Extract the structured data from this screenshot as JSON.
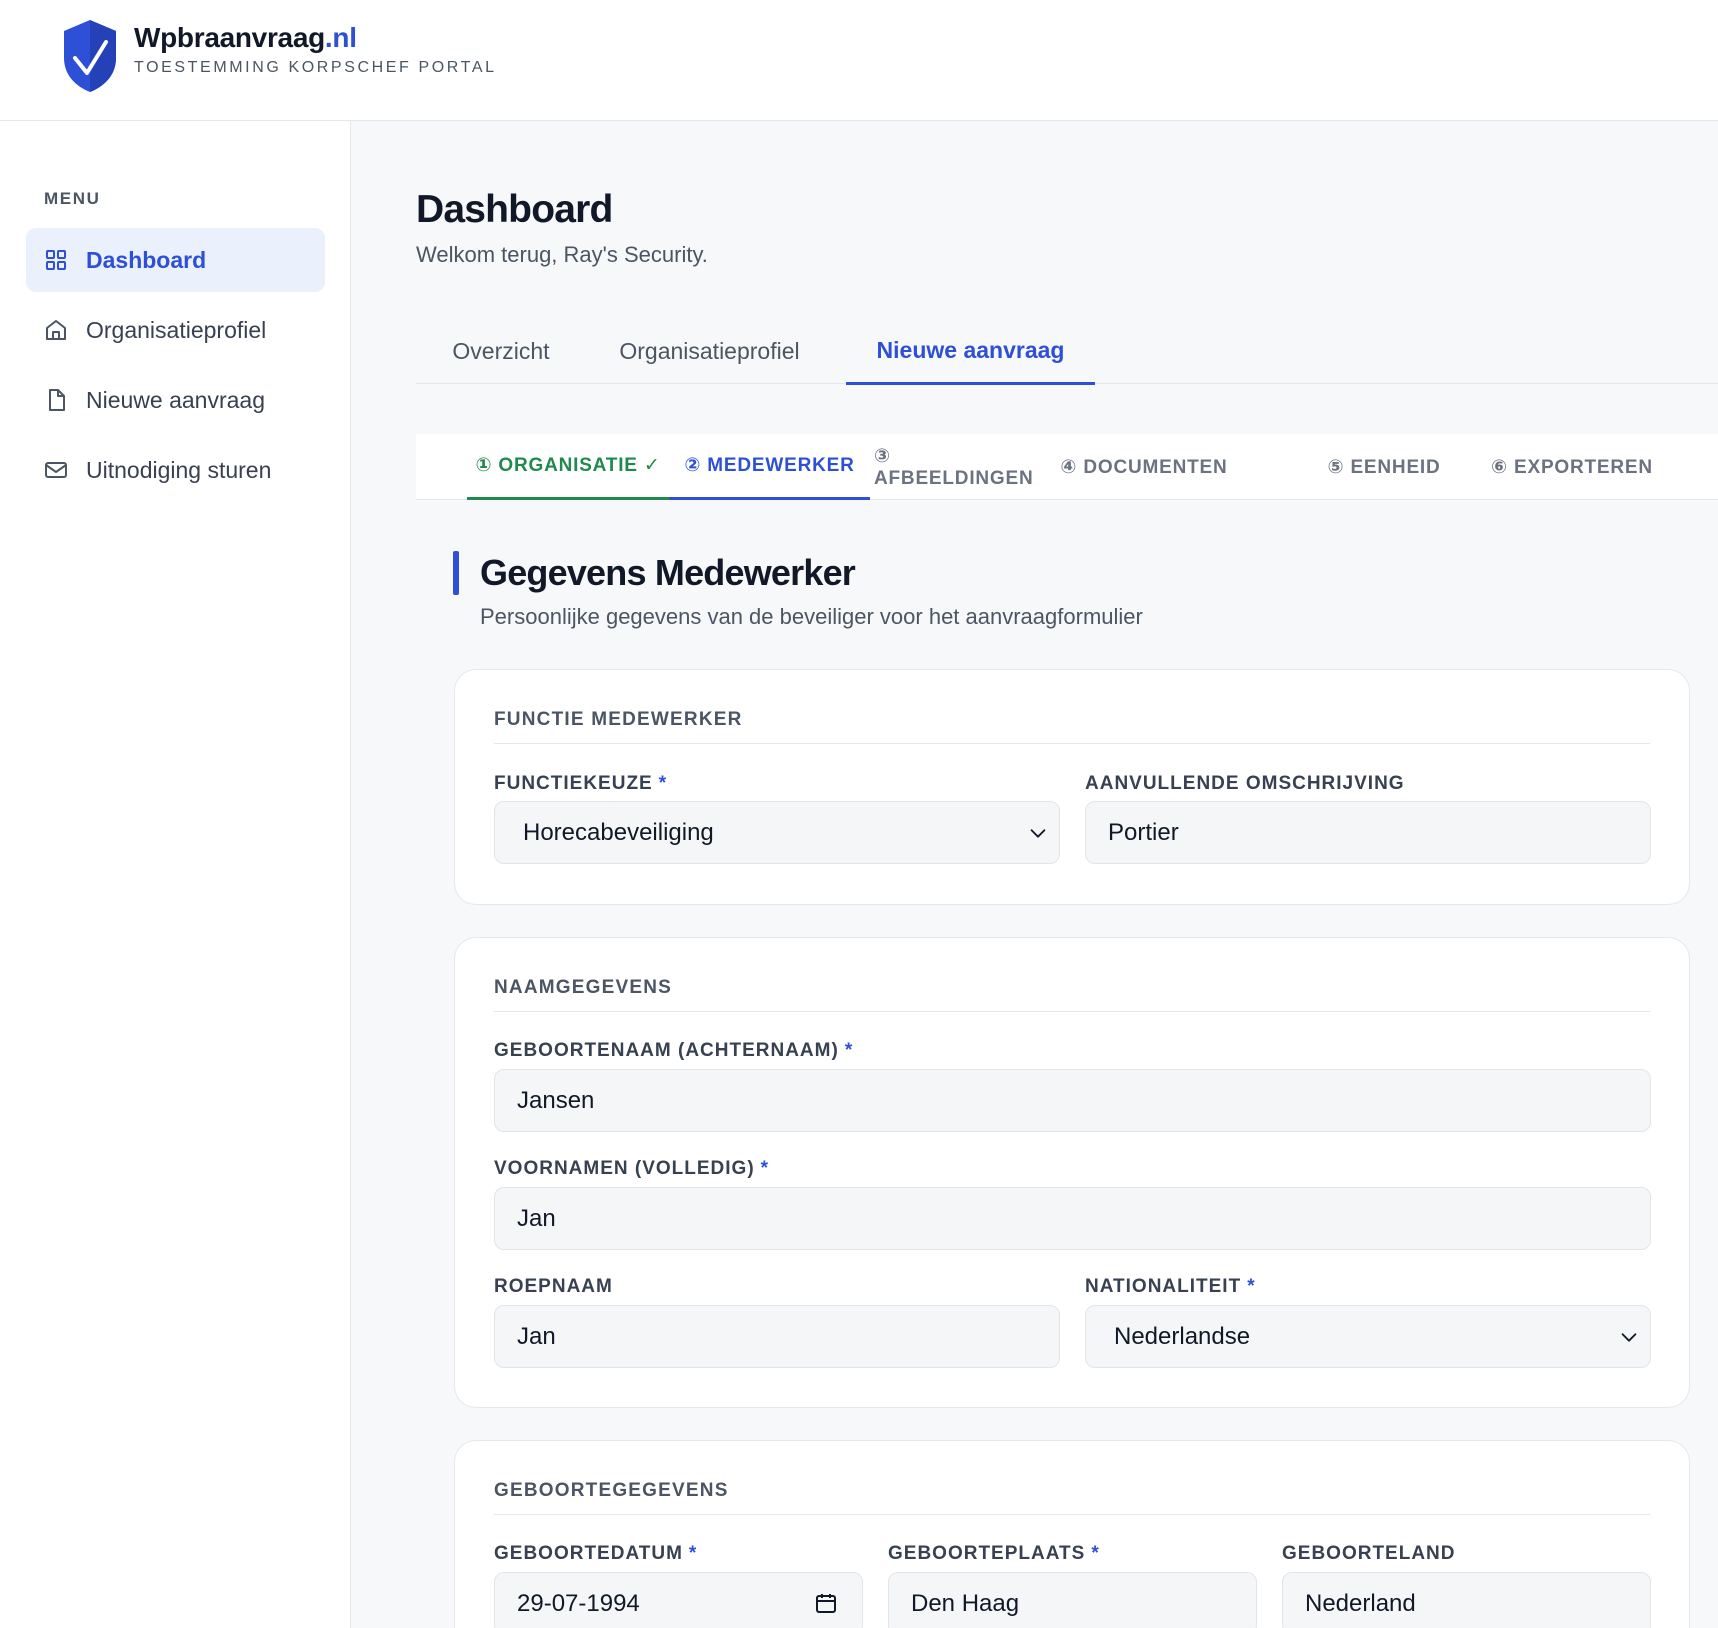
{
  "header": {
    "brand_name": "Wpbraanvraag",
    "brand_tld": ".nl",
    "brand_subtitle": "TOESTEMMING KORPSCHEF PORTAL"
  },
  "sidebar": {
    "menu_label": "MENU",
    "items": [
      {
        "label": "Dashboard",
        "icon": "grid-icon",
        "active": true
      },
      {
        "label": "Organisatieprofiel",
        "icon": "home-icon",
        "active": false
      },
      {
        "label": "Nieuwe aanvraag",
        "icon": "file-icon",
        "active": false
      },
      {
        "label": "Uitnodiging sturen",
        "icon": "mail-icon",
        "active": false
      }
    ]
  },
  "page": {
    "title": "Dashboard",
    "subtitle": "Welkom terug, Ray's Security."
  },
  "tabs": [
    {
      "label": "Overzicht",
      "active": false
    },
    {
      "label": "Organisatieprofiel",
      "active": false
    },
    {
      "label": "Nieuwe aanvraag",
      "active": true
    }
  ],
  "steps": [
    {
      "label": "① ORGANISATIE ✓",
      "state": "done"
    },
    {
      "label": "② MEDEWERKER",
      "state": "active"
    },
    {
      "label": "③ AFBEELDINGEN",
      "state": "todo"
    },
    {
      "label": "④ DOCUMENTEN",
      "state": "todo"
    },
    {
      "label": "⑤ EENHEID",
      "state": "todo"
    },
    {
      "label": "⑥ EXPORTEREN",
      "state": "todo"
    }
  ],
  "section": {
    "title": "Gegevens Medewerker",
    "subtitle": "Persoonlijke gegevens van de beveiliger voor het aanvraagformulier"
  },
  "cards": {
    "functie": {
      "title": "FUNCTIE MEDEWERKER",
      "functiekeuze_label": "FUNCTIEKEUZE",
      "functiekeuze_value": "Horecabeveiliging",
      "omschrijving_label": "AANVULLENDE OMSCHRIJVING",
      "omschrijving_value": "Portier"
    },
    "naam": {
      "title": "NAAMGEGEVENS",
      "geboortenaam_label": "GEBOORTENAAM (ACHTERNAAM)",
      "geboortenaam_value": "Jansen",
      "voornamen_label": "VOORNAMEN (VOLLEDIG)",
      "voornamen_value": "Jan",
      "roepnaam_label": "ROEPNAAM",
      "roepnaam_value": "Jan",
      "nationaliteit_label": "NATIONALITEIT",
      "nationaliteit_value": "Nederlandse"
    },
    "geboorte": {
      "title": "GEBOORTEGEGEVENS",
      "datum_label": "GEBOORTEDATUM",
      "datum_value": "29-07-1994",
      "plaats_label": "GEBOORTEPLAATS",
      "plaats_value": "Den Haag",
      "land_label": "GEBOORTELAND",
      "land_value": "Nederland"
    }
  },
  "required_marker": "*",
  "colors": {
    "accent": "#2d50d6",
    "success": "#1f8a4c",
    "background": "#f7f8fa"
  }
}
